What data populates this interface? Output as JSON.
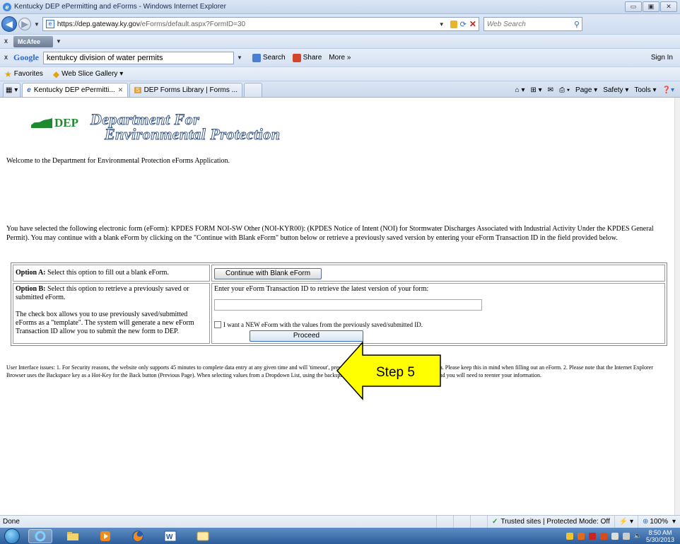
{
  "window": {
    "title": "Kentucky DEP ePermitting and eForms - Windows Internet Explorer",
    "controls": [
      "▭",
      "▣",
      "✕"
    ]
  },
  "address": {
    "url_main": "https://dep.gateway.ky.gov",
    "url_rest": "/eForms/default.aspx?FormID=30",
    "search_placeholder": "Web Search"
  },
  "mcafee": {
    "close": "x",
    "label": "McAfee"
  },
  "google_bar": {
    "close": "x",
    "logo": "Google",
    "query": "kentukcy division of water permits",
    "search": "Search",
    "share": "Share",
    "more": "More »",
    "signin": "Sign In"
  },
  "favorites": {
    "label": "Favorites",
    "web_slice": "Web Slice Gallery ▾"
  },
  "tabs": [
    {
      "label": "Kentucky DEP ePermitti...",
      "active": true
    },
    {
      "label": "DEP Forms Library | Forms ...",
      "active": false
    }
  ],
  "command_bar": {
    "page": "Page ▾",
    "safety": "Safety ▾",
    "tools": "Tools ▾"
  },
  "page": {
    "logo_word": "DEP",
    "title_line1": "Department For",
    "title_line2": "Environmental Protection",
    "welcome": "Welcome to the Department for Environmental Protection eForms Application.",
    "intro": "You have selected the following electronic form (eForm): KPDES FORM NOI-SW Other (NOI-KYR00): (KPDES Notice of Intent (NOI) for Stormwater Discharges Associated with Industrial Activity Under the KPDES General Permit). You may continue with a blank eForm by clicking on the \"Continue with Blank eForm\" button below or retrieve a previously saved version by entering your eForm Transaction ID in the field provided below.",
    "option_a_label": "Option A:",
    "option_a_text": " Select this option to fill out a blank eForm.",
    "continue_button": "Continue with Blank eForm",
    "option_b_label": "Option B:",
    "option_b_text": " Select this option to retrieve a previously saved or submitted eForm.",
    "option_b_template": "The check box allows you to use previously saved/submitted eForms as a \"template\".  The system will generate a new eForm Transaction ID allow you to submit the new form to DEP.",
    "transaction_prompt": "Enter your eForm Transaction ID to retrieve the latest version of your form:",
    "transaction_value": "",
    "new_eform_checkbox": "I want a NEW eForm with the values from the previously saved/submitted ID.",
    "proceed_button": "Proceed",
    "issues": "User Interface issues: 1. For Security reasons, the website only supports 45 minutes to complete data entry at any given time and will 'timeout', preventing the ability to save or submit your data. Please keep this in mind when filling out an eForm. 2. Please note that the Internet Explorer Browser uses the Backspace key as a Hot-Key for the Back button (Previous Page). When selecting values from a Dropdown List, using the backspace key will take you to the previous page and you will need to reenter your information."
  },
  "annotation": {
    "label": "Step 5",
    "fill": "#ffff00"
  },
  "status": {
    "left": "Done",
    "zone": "Trusted sites | Protected Mode: Off",
    "zoom": "100%"
  },
  "taskbar": {
    "time": "8:50 AM",
    "date": "5/30/2013"
  },
  "colors": {
    "dep_green": "#1e8a2e",
    "title_stroke": "#3d5c8a",
    "chrome_blue": "#cedcf0"
  }
}
